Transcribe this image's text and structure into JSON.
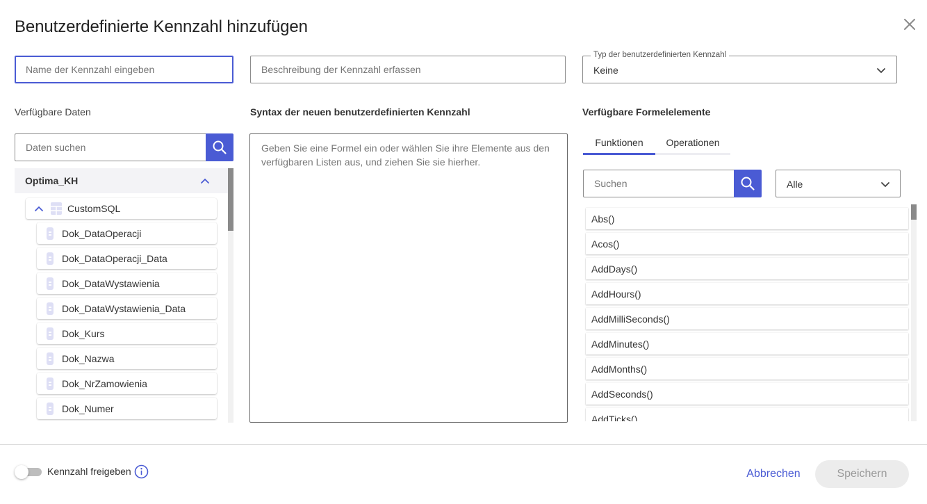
{
  "dialog": {
    "title": "Benutzerdefinierte Kennzahl hinzufügen",
    "close_icon": "close-icon"
  },
  "name_input": {
    "placeholder": "Name der Kennzahl eingeben"
  },
  "description_input": {
    "placeholder": "Beschreibung der Kennzahl erfassen"
  },
  "type_select": {
    "legend": "Typ der benutzerdefinierten Kennzahl",
    "value": "Keine"
  },
  "available_data": {
    "label": "Verfügbare Daten",
    "search_placeholder": "Daten suchen",
    "root": "Optima_KH",
    "table": "CustomSQL",
    "fields": [
      "Dok_DataOperacji",
      "Dok_DataOperacji_Data",
      "Dok_DataWystawienia",
      "Dok_DataWystawienia_Data",
      "Dok_Kurs",
      "Dok_Nazwa",
      "Dok_NrZamowienia",
      "Dok_Numer"
    ]
  },
  "syntax": {
    "label": "Syntax der neuen benutzerdefinierten Kennzahl",
    "placeholder": "Geben Sie eine Formel ein oder wählen Sie ihre Elemente aus den verfügbaren Listen aus, und ziehen Sie sie hierher."
  },
  "formula_elements": {
    "label": "Verfügbare Formelelemente",
    "tabs": [
      "Funktionen",
      "Operationen"
    ],
    "active_tab": "Funktionen",
    "search_placeholder": "Suchen",
    "filter_value": "Alle",
    "functions": [
      "Abs()",
      "Acos()",
      "AddDays()",
      "AddHours()",
      "AddMilliSeconds()",
      "AddMinutes()",
      "AddMonths()",
      "AddSeconds()",
      "AddTicks()"
    ]
  },
  "footer": {
    "toggle_label": "Kennzahl freigeben",
    "toggle_on": false,
    "cancel_label": "Abbrechen",
    "save_label": "Speichern"
  },
  "colors": {
    "accent": "#4a5bd4",
    "border": "#8c8c8c",
    "tree_bg": "#f3f3f6"
  }
}
